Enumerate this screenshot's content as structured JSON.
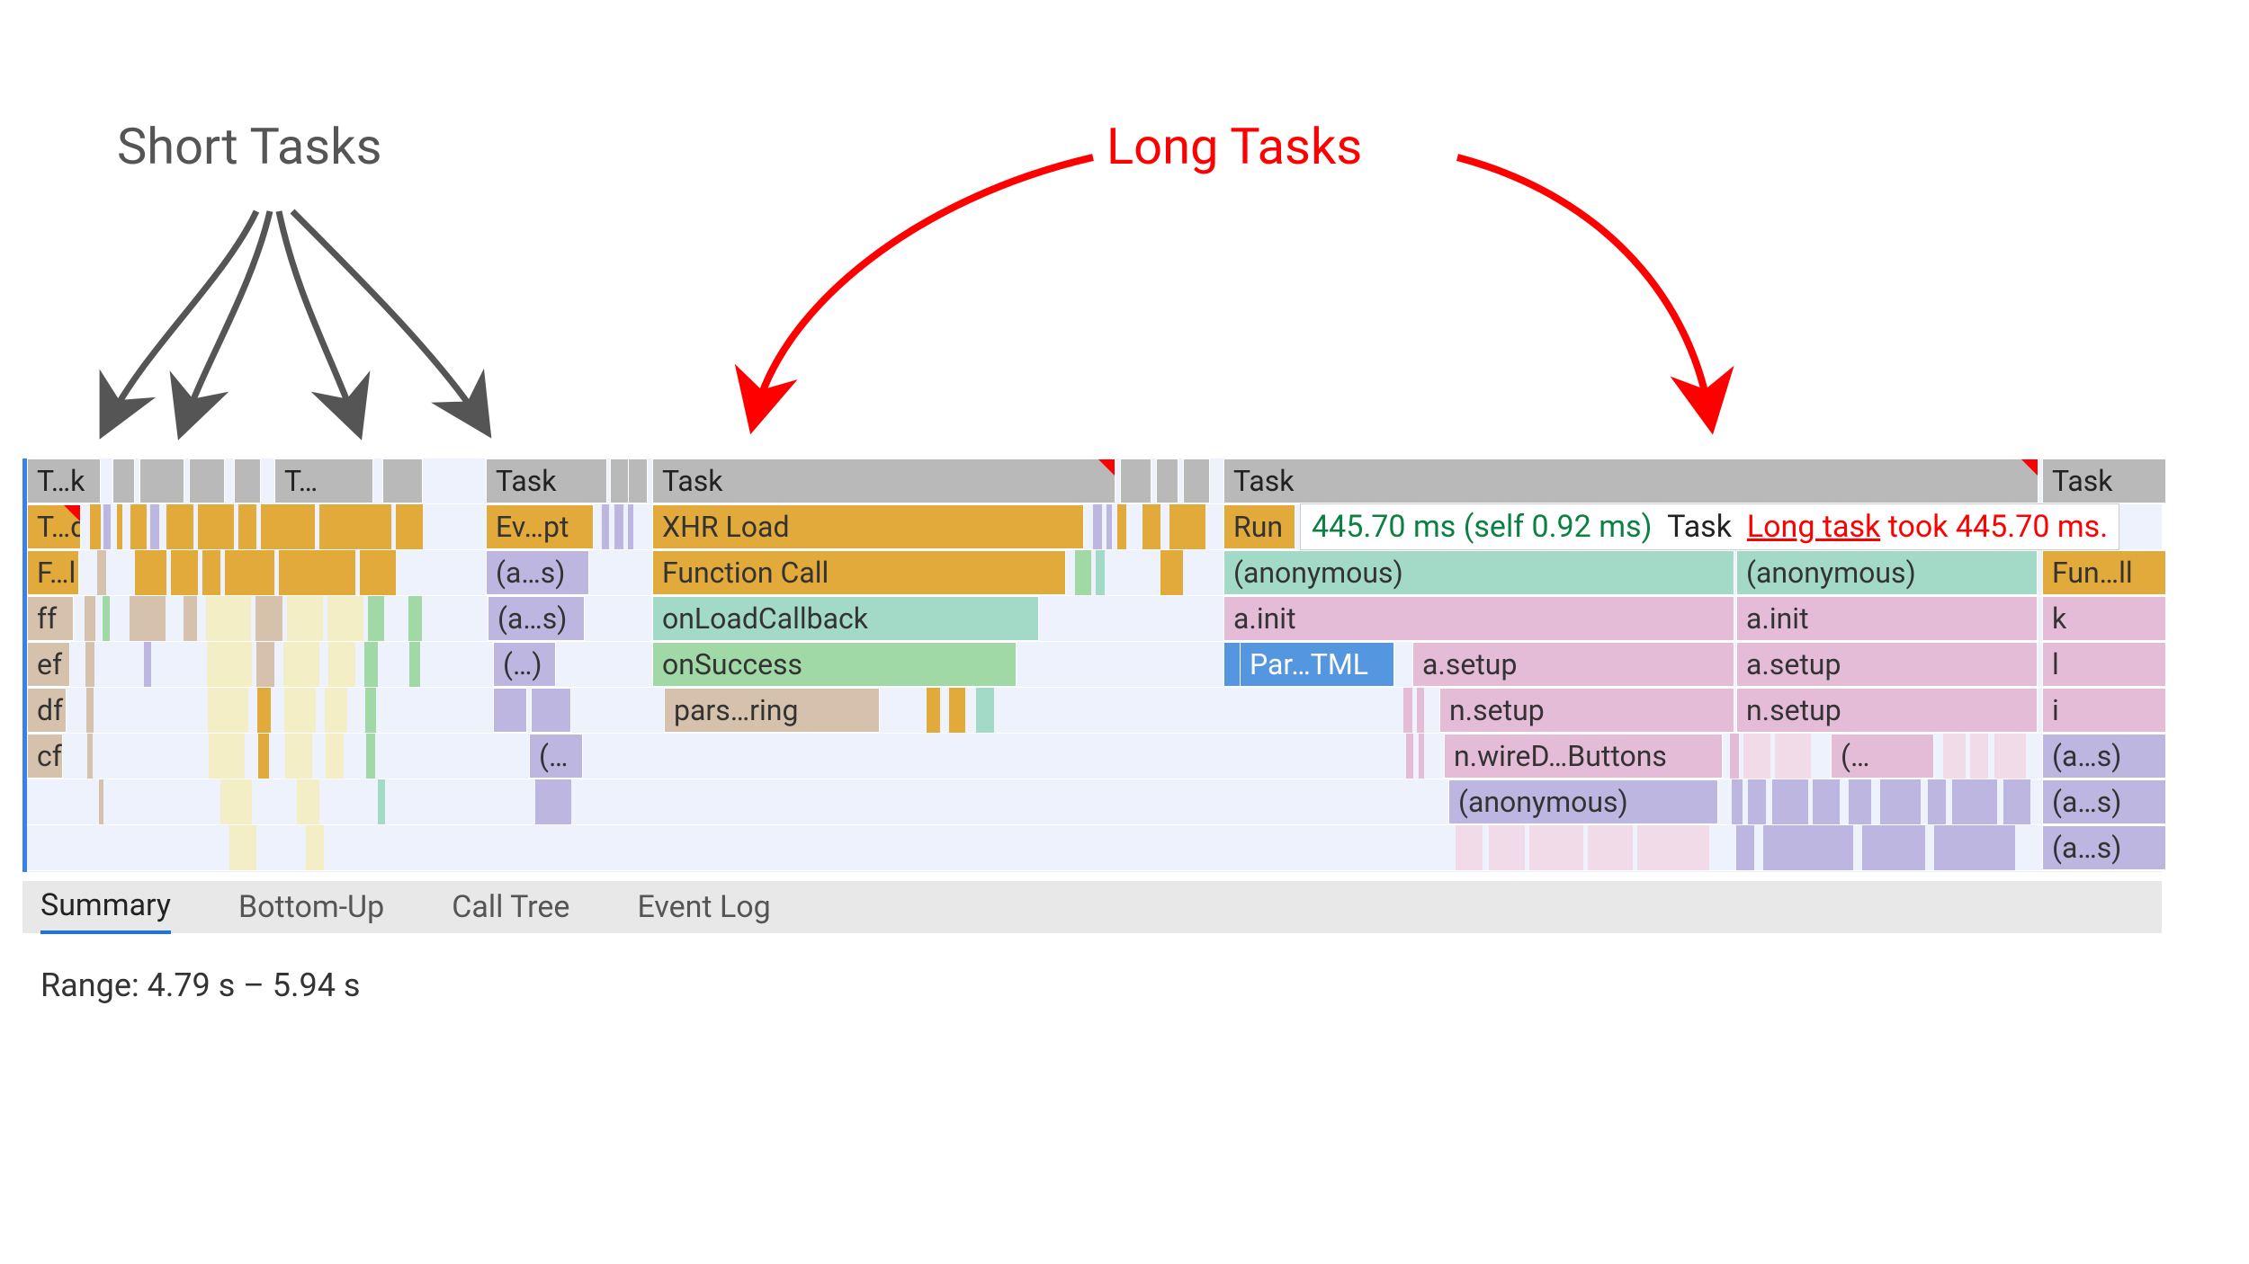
{
  "annotations": {
    "short_tasks_label": "Short Tasks",
    "long_tasks_label": "Long Tasks"
  },
  "tooltip": {
    "time": "445.70 ms (self 0.92 ms)",
    "task": "Task",
    "long_task_label": "Long task",
    "took": "took 445.70 ms."
  },
  "tabs": {
    "summary": "Summary",
    "bottom_up": "Bottom-Up",
    "call_tree": "Call Tree",
    "event_log": "Event Log"
  },
  "range": "Range:  4.79 s – 5.94 s",
  "flame": {
    "r0": {
      "tk_left": "T…k",
      "tk_left2": "T…",
      "task1": "Task",
      "task2": "Task",
      "task3": "Task",
      "task4": "Task"
    },
    "r1": {
      "td": "T…d",
      "evpt": "Ev…pt",
      "xhr": "XHR Load",
      "run": "Run"
    },
    "r2": {
      "fl": "F…l",
      "as1": "(a…s)",
      "fc": "Function Call",
      "anon1": "(anonymous)",
      "anon2": "(anonymous)",
      "funll": "Fun…ll"
    },
    "r3": {
      "ff": "ff",
      "as2": "(a…s)",
      "olc": "onLoadCallback",
      "ainit1": "a.init",
      "ainit2": "a.init",
      "k": "k"
    },
    "r4": {
      "ef": "ef",
      "paren": "(…)",
      "ons": "onSuccess",
      "partml": "Par…TML",
      "asetup1": "a.setup",
      "asetup2": "a.setup",
      "l": "l"
    },
    "r5": {
      "df": "df",
      "parsring": "pars…ring",
      "nsetup1": "n.setup",
      "nsetup2": "n.setup",
      "i": "i"
    },
    "r6": {
      "cf": "cf",
      "paren2": "(…",
      "wired": "n.wireD…Buttons",
      "paren3": "(…",
      "as3": "(a…s)"
    },
    "r7": {
      "anon3": "(anonymous)",
      "as4": "(a…s)"
    },
    "r8": {
      "as5": "(a…s)"
    }
  }
}
